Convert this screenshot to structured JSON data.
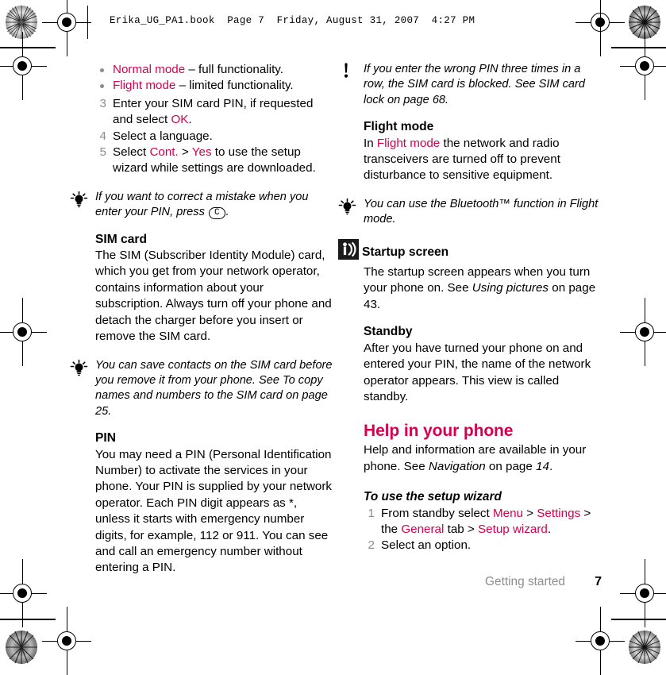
{
  "header": {
    "slug": "Erika_UG_PA1.book  Page 7  Friday, August 31, 2007  4:27 PM"
  },
  "left_column": {
    "bullets": [
      {
        "term": "Normal mode",
        "rest": " – full functionality."
      },
      {
        "term": "Flight mode",
        "rest": " – limited functionality."
      }
    ],
    "steps": [
      {
        "num": "3",
        "pre": "Enter your SIM card PIN, if requested and select ",
        "link": "OK",
        "post": "."
      },
      {
        "num": "4",
        "pre": "Select a language.",
        "link": "",
        "post": ""
      },
      {
        "num": "5",
        "pre": "Select ",
        "link": "Cont.",
        "mid": " > ",
        "link2": "Yes",
        "post": " to use the setup wizard while settings are downloaded."
      }
    ],
    "tip1": {
      "icon": "lightbulb-icon",
      "text_before": "If you want to correct a mistake when you enter your PIN, press ",
      "keycap": "C",
      "text_after": "."
    },
    "sim_card": {
      "heading": "SIM card",
      "body": "The SIM (Subscriber Identity Module) card, which you get from your network operator, contains information about your subscription. Always turn off your phone and detach the charger before you insert or remove the SIM card."
    },
    "tip2": {
      "icon": "lightbulb-icon",
      "text": "You can save contacts on the SIM card before you remove it from your phone. See To copy names and numbers to the SIM card on page 25."
    },
    "pin": {
      "heading": "PIN",
      "body": "You may need a PIN (Personal Identification Number) to activate the services in your phone. Your PIN is supplied by your network operator. Each PIN digit appears as *, unless it starts with emergency number digits, for example, 112 or 911. You can see and call an emergency number without entering a PIN."
    }
  },
  "right_column": {
    "warning": {
      "icon": "exclamation-icon",
      "text": "If you enter the wrong PIN three times in a row, the SIM card is blocked. See SIM card lock on page 68."
    },
    "flight_mode": {
      "heading": "Flight mode",
      "pre": "In ",
      "link": "Flight mode",
      "post": " the network and radio transceivers are turned off to prevent disturbance to sensitive equipment."
    },
    "tip3": {
      "icon": "lightbulb-icon",
      "text": "You can use the Bluetooth™ function in Flight mode."
    },
    "startup_screen": {
      "icon": "broadcast-square-icon",
      "heading": "Startup screen",
      "pre": "The startup screen appears when you turn your phone on. See ",
      "italic": "Using pictures",
      "post": " on page 43."
    },
    "standby": {
      "heading": "Standby",
      "body": "After you have turned your phone on and entered your PIN, the name of the network operator appears. This view is called standby."
    },
    "help": {
      "heading": "Help in your phone",
      "pre": "Help and information are available in your phone. See ",
      "italic": "Navigation",
      "mid": " on page ",
      "italic2": "14",
      "post": "."
    },
    "setup_wizard": {
      "title": "To use the setup wizard",
      "steps": [
        {
          "num": "1",
          "pre": "From standby select ",
          "link1": "Menu",
          "sep1": " > ",
          "link2": "Settings",
          "sep2": " > the ",
          "link3": "General",
          "sep3": " tab > ",
          "link4": "Setup wizard",
          "post": "."
        },
        {
          "num": "2",
          "pre": "Select an option.",
          "link1": "",
          "sep1": "",
          "link2": "",
          "sep2": "",
          "link3": "",
          "sep3": "",
          "link4": "",
          "post": ""
        }
      ]
    }
  },
  "footer": {
    "section": "Getting started",
    "page_number": "7"
  },
  "colors": {
    "accent_pink": "#d6004f",
    "muted_gray": "#8d8d8d",
    "text_black": "#000000"
  }
}
